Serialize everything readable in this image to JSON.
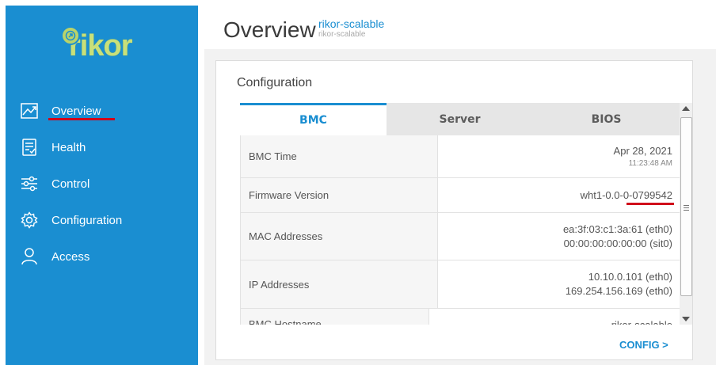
{
  "brand": {
    "logo_text": "rikor"
  },
  "nav": {
    "items": [
      {
        "label": "Overview",
        "icon": "chart-line-icon"
      },
      {
        "label": "Health",
        "icon": "clipboard-list-icon"
      },
      {
        "label": "Control",
        "icon": "sliders-icon"
      },
      {
        "label": "Configuration",
        "icon": "gear-icon"
      },
      {
        "label": "Access",
        "icon": "user-icon"
      }
    ]
  },
  "header": {
    "title": "Overview",
    "host": "rikor-scalable",
    "host_sub": "rikor-scalable"
  },
  "panel": {
    "title": "Configuration",
    "tabs": [
      "BMC",
      "Server",
      "BIOS"
    ],
    "rows": [
      {
        "label": "BMC Time",
        "value": "Apr 28, 2021",
        "sub": "11:23:48 AM"
      },
      {
        "label": "Firmware Version",
        "value": "wht1-0.0-0-0799542"
      },
      {
        "label": "MAC Addresses",
        "value": "ea:3f:03:c1:3a:61 (eth0)",
        "sub": "00:00:00:00:00:00 (sit0)"
      },
      {
        "label": "IP Addresses",
        "value": "10.10.0.101 (eth0)",
        "sub": "169.254.156.169 (eth0)"
      },
      {
        "label": "BMC Hostname",
        "value": "rikor-scalable"
      }
    ],
    "link": "CONFIG >"
  },
  "colors": {
    "accent": "#1a8ed1",
    "highlight": "#d0021b",
    "logo": "#c8e07a"
  }
}
